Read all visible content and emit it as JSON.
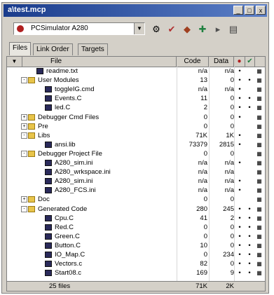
{
  "window": {
    "title": "a\\test.mcp",
    "btn_min": "_",
    "btn_max": "□",
    "btn_close": "x"
  },
  "toolbar": {
    "target": "PCSimulator A280"
  },
  "tabs": [
    "Files",
    "Link Order",
    "Targets"
  ],
  "columns": {
    "file": "File",
    "code": "Code",
    "data": "Data"
  },
  "rows": [
    {
      "depth": 1,
      "type": "file",
      "toggle": "",
      "name": "readme.txt",
      "code": "n/a",
      "data": "n/a",
      "dot": true,
      "check": false
    },
    {
      "depth": 0,
      "type": "folder",
      "toggle": "-",
      "name": "User Modules",
      "code": "13",
      "data": "0",
      "dot": true,
      "check": true
    },
    {
      "depth": 2,
      "type": "file",
      "toggle": "",
      "name": "toggleIG.cmd",
      "code": "n/a",
      "data": "n/a",
      "dot": true,
      "check": false
    },
    {
      "depth": 2,
      "type": "file",
      "toggle": "",
      "name": "Events.C",
      "code": "11",
      "data": "0",
      "dot": true,
      "check": true
    },
    {
      "depth": 2,
      "type": "file",
      "toggle": "",
      "name": "led.C",
      "code": "2",
      "data": "0",
      "dot": true,
      "check": true
    },
    {
      "depth": 0,
      "type": "folder",
      "toggle": "+",
      "name": "Debugger Cmd Files",
      "code": "0",
      "data": "0",
      "dot": true,
      "check": false
    },
    {
      "depth": 0,
      "type": "folder",
      "toggle": "+",
      "name": "Pre",
      "code": "0",
      "data": "0",
      "dot": false,
      "check": false
    },
    {
      "depth": 0,
      "type": "folder",
      "toggle": "-",
      "name": "Libs",
      "code": "71K",
      "data": "1K",
      "dot": true,
      "check": false
    },
    {
      "depth": 2,
      "type": "file",
      "toggle": "",
      "name": "ansi.lib",
      "code": "73379",
      "data": "2815",
      "dot": true,
      "check": false
    },
    {
      "depth": 0,
      "type": "folder",
      "toggle": "-",
      "name": "Debugger Project File",
      "code": "0",
      "data": "0",
      "dot": false,
      "check": false
    },
    {
      "depth": 2,
      "type": "file",
      "toggle": "",
      "name": "A280_sim.ini",
      "code": "n/a",
      "data": "n/a",
      "dot": true,
      "check": false
    },
    {
      "depth": 2,
      "type": "file",
      "toggle": "",
      "name": "A280_wrkspace.ini",
      "code": "n/a",
      "data": "n/a",
      "dot": false,
      "check": false
    },
    {
      "depth": 2,
      "type": "file",
      "toggle": "",
      "name": "A280_sim.ini",
      "code": "n/a",
      "data": "n/a",
      "dot": true,
      "check": false
    },
    {
      "depth": 2,
      "type": "file",
      "toggle": "",
      "name": "A280_FCS.ini",
      "code": "n/a",
      "data": "n/a",
      "dot": true,
      "check": false
    },
    {
      "depth": 0,
      "type": "folder",
      "toggle": "+",
      "name": "Doc",
      "code": "0",
      "data": "0",
      "dot": false,
      "check": false
    },
    {
      "depth": 0,
      "type": "folder",
      "toggle": "-",
      "name": "Generated Code",
      "code": "280",
      "data": "245",
      "dot": true,
      "check": true
    },
    {
      "depth": 2,
      "type": "file",
      "toggle": "",
      "name": "Cpu.C",
      "code": "41",
      "data": "2",
      "dot": true,
      "check": true
    },
    {
      "depth": 2,
      "type": "file",
      "toggle": "",
      "name": "Red.C",
      "code": "0",
      "data": "0",
      "dot": true,
      "check": true
    },
    {
      "depth": 2,
      "type": "file",
      "toggle": "",
      "name": "Green.C",
      "code": "0",
      "data": "0",
      "dot": true,
      "check": true
    },
    {
      "depth": 2,
      "type": "file",
      "toggle": "",
      "name": "Button.C",
      "code": "10",
      "data": "0",
      "dot": true,
      "check": true
    },
    {
      "depth": 2,
      "type": "file",
      "toggle": "",
      "name": "IO_Map.C",
      "code": "0",
      "data": "234",
      "dot": true,
      "check": true
    },
    {
      "depth": 2,
      "type": "file",
      "toggle": "",
      "name": "Vectors.c",
      "code": "82",
      "data": "0",
      "dot": true,
      "check": true
    },
    {
      "depth": 2,
      "type": "file",
      "toggle": "",
      "name": "Start08.c",
      "code": "169",
      "data": "9",
      "dot": true,
      "check": true
    }
  ],
  "footer": {
    "count": "25 files",
    "code": "71K",
    "data": "2K"
  }
}
